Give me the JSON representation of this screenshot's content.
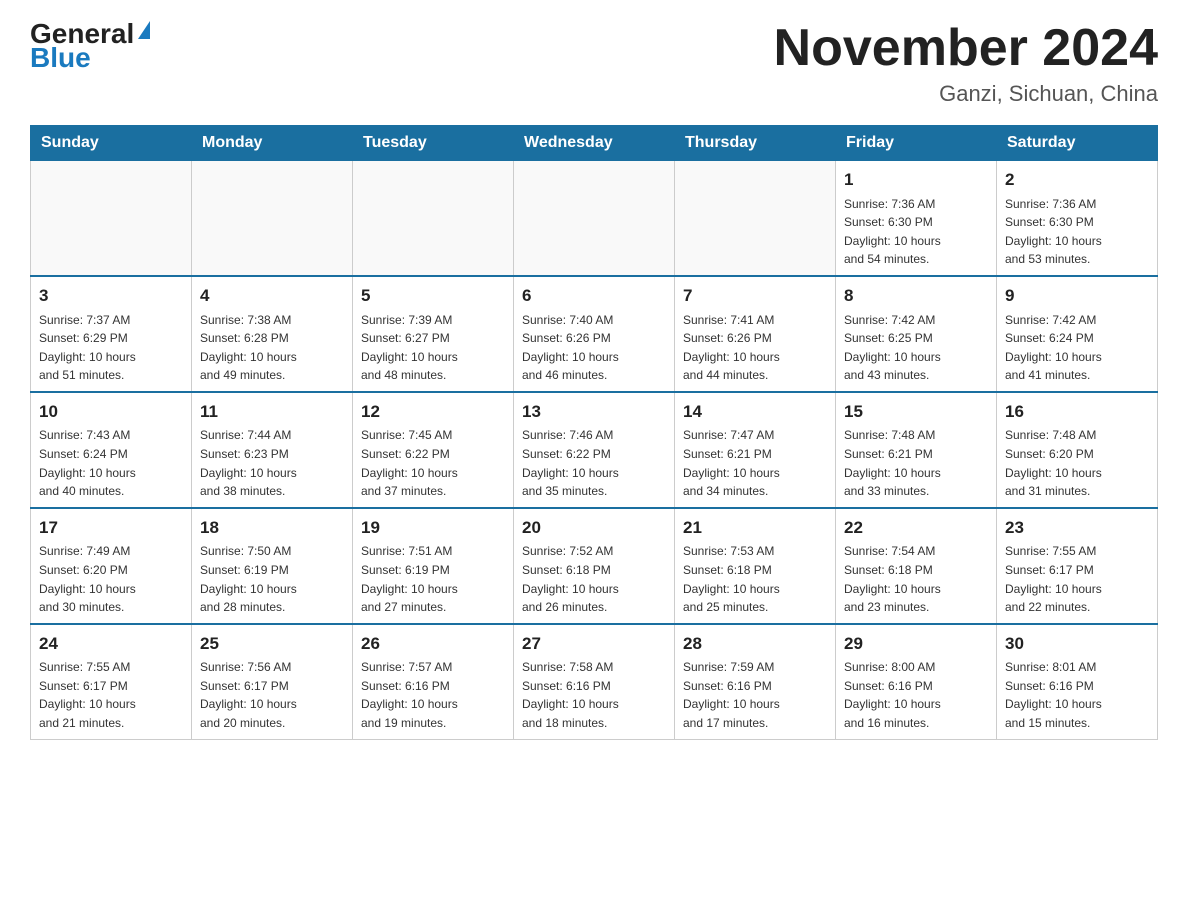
{
  "header": {
    "logo_general": "General",
    "logo_blue": "Blue",
    "month": "November 2024",
    "location": "Ganzi, Sichuan, China"
  },
  "weekdays": [
    "Sunday",
    "Monday",
    "Tuesday",
    "Wednesday",
    "Thursday",
    "Friday",
    "Saturday"
  ],
  "weeks": [
    [
      {
        "day": "",
        "info": ""
      },
      {
        "day": "",
        "info": ""
      },
      {
        "day": "",
        "info": ""
      },
      {
        "day": "",
        "info": ""
      },
      {
        "day": "",
        "info": ""
      },
      {
        "day": "1",
        "info": "Sunrise: 7:36 AM\nSunset: 6:30 PM\nDaylight: 10 hours\nand 54 minutes."
      },
      {
        "day": "2",
        "info": "Sunrise: 7:36 AM\nSunset: 6:30 PM\nDaylight: 10 hours\nand 53 minutes."
      }
    ],
    [
      {
        "day": "3",
        "info": "Sunrise: 7:37 AM\nSunset: 6:29 PM\nDaylight: 10 hours\nand 51 minutes."
      },
      {
        "day": "4",
        "info": "Sunrise: 7:38 AM\nSunset: 6:28 PM\nDaylight: 10 hours\nand 49 minutes."
      },
      {
        "day": "5",
        "info": "Sunrise: 7:39 AM\nSunset: 6:27 PM\nDaylight: 10 hours\nand 48 minutes."
      },
      {
        "day": "6",
        "info": "Sunrise: 7:40 AM\nSunset: 6:26 PM\nDaylight: 10 hours\nand 46 minutes."
      },
      {
        "day": "7",
        "info": "Sunrise: 7:41 AM\nSunset: 6:26 PM\nDaylight: 10 hours\nand 44 minutes."
      },
      {
        "day": "8",
        "info": "Sunrise: 7:42 AM\nSunset: 6:25 PM\nDaylight: 10 hours\nand 43 minutes."
      },
      {
        "day": "9",
        "info": "Sunrise: 7:42 AM\nSunset: 6:24 PM\nDaylight: 10 hours\nand 41 minutes."
      }
    ],
    [
      {
        "day": "10",
        "info": "Sunrise: 7:43 AM\nSunset: 6:24 PM\nDaylight: 10 hours\nand 40 minutes."
      },
      {
        "day": "11",
        "info": "Sunrise: 7:44 AM\nSunset: 6:23 PM\nDaylight: 10 hours\nand 38 minutes."
      },
      {
        "day": "12",
        "info": "Sunrise: 7:45 AM\nSunset: 6:22 PM\nDaylight: 10 hours\nand 37 minutes."
      },
      {
        "day": "13",
        "info": "Sunrise: 7:46 AM\nSunset: 6:22 PM\nDaylight: 10 hours\nand 35 minutes."
      },
      {
        "day": "14",
        "info": "Sunrise: 7:47 AM\nSunset: 6:21 PM\nDaylight: 10 hours\nand 34 minutes."
      },
      {
        "day": "15",
        "info": "Sunrise: 7:48 AM\nSunset: 6:21 PM\nDaylight: 10 hours\nand 33 minutes."
      },
      {
        "day": "16",
        "info": "Sunrise: 7:48 AM\nSunset: 6:20 PM\nDaylight: 10 hours\nand 31 minutes."
      }
    ],
    [
      {
        "day": "17",
        "info": "Sunrise: 7:49 AM\nSunset: 6:20 PM\nDaylight: 10 hours\nand 30 minutes."
      },
      {
        "day": "18",
        "info": "Sunrise: 7:50 AM\nSunset: 6:19 PM\nDaylight: 10 hours\nand 28 minutes."
      },
      {
        "day": "19",
        "info": "Sunrise: 7:51 AM\nSunset: 6:19 PM\nDaylight: 10 hours\nand 27 minutes."
      },
      {
        "day": "20",
        "info": "Sunrise: 7:52 AM\nSunset: 6:18 PM\nDaylight: 10 hours\nand 26 minutes."
      },
      {
        "day": "21",
        "info": "Sunrise: 7:53 AM\nSunset: 6:18 PM\nDaylight: 10 hours\nand 25 minutes."
      },
      {
        "day": "22",
        "info": "Sunrise: 7:54 AM\nSunset: 6:18 PM\nDaylight: 10 hours\nand 23 minutes."
      },
      {
        "day": "23",
        "info": "Sunrise: 7:55 AM\nSunset: 6:17 PM\nDaylight: 10 hours\nand 22 minutes."
      }
    ],
    [
      {
        "day": "24",
        "info": "Sunrise: 7:55 AM\nSunset: 6:17 PM\nDaylight: 10 hours\nand 21 minutes."
      },
      {
        "day": "25",
        "info": "Sunrise: 7:56 AM\nSunset: 6:17 PM\nDaylight: 10 hours\nand 20 minutes."
      },
      {
        "day": "26",
        "info": "Sunrise: 7:57 AM\nSunset: 6:16 PM\nDaylight: 10 hours\nand 19 minutes."
      },
      {
        "day": "27",
        "info": "Sunrise: 7:58 AM\nSunset: 6:16 PM\nDaylight: 10 hours\nand 18 minutes."
      },
      {
        "day": "28",
        "info": "Sunrise: 7:59 AM\nSunset: 6:16 PM\nDaylight: 10 hours\nand 17 minutes."
      },
      {
        "day": "29",
        "info": "Sunrise: 8:00 AM\nSunset: 6:16 PM\nDaylight: 10 hours\nand 16 minutes."
      },
      {
        "day": "30",
        "info": "Sunrise: 8:01 AM\nSunset: 6:16 PM\nDaylight: 10 hours\nand 15 minutes."
      }
    ]
  ]
}
